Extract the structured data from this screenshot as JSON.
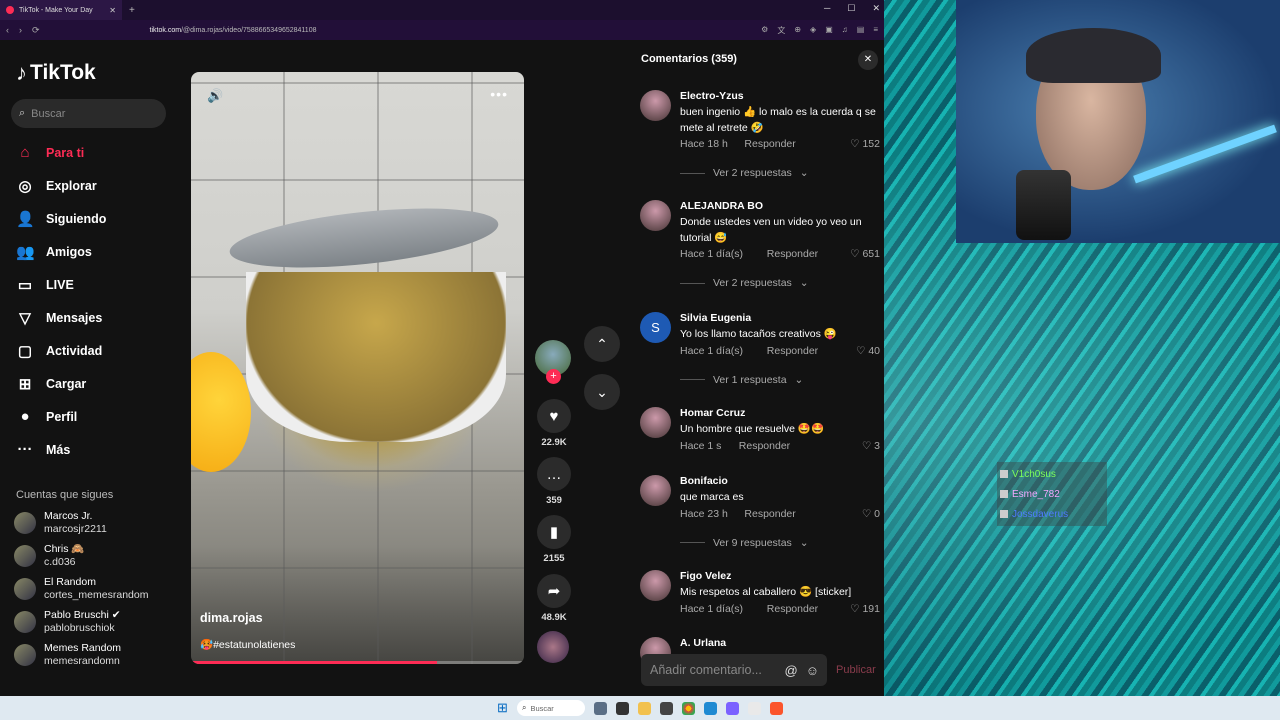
{
  "browser": {
    "tab_title": "TikTok - Make Your Day",
    "url_domain": "tiktok.com",
    "url_path": "/@dima.rojas/video/7588665349652841108",
    "new_tab": "+",
    "back": "‹",
    "forward": "›",
    "reload": "⟳"
  },
  "sidebar": {
    "logo": "TikTok",
    "search_placeholder": "Buscar",
    "nav": [
      {
        "label": "Para ti",
        "icon": "home-icon",
        "glyph": "⌂",
        "active": true
      },
      {
        "label": "Explorar",
        "icon": "compass-icon",
        "glyph": "◎"
      },
      {
        "label": "Siguiendo",
        "icon": "following-icon",
        "glyph": "👤"
      },
      {
        "label": "Amigos",
        "icon": "friends-icon",
        "glyph": "👥"
      },
      {
        "label": "LIVE",
        "icon": "live-icon",
        "glyph": "▭"
      },
      {
        "label": "Mensajes",
        "icon": "messages-icon",
        "glyph": "▽"
      },
      {
        "label": "Actividad",
        "icon": "activity-icon",
        "glyph": "▢"
      },
      {
        "label": "Cargar",
        "icon": "upload-icon",
        "glyph": "⊞"
      },
      {
        "label": "Perfil",
        "icon": "profile-icon",
        "glyph": "●"
      },
      {
        "label": "Más",
        "icon": "more-icon",
        "glyph": "···"
      }
    ],
    "following_title": "Cuentas que sigues",
    "following": [
      {
        "name": "Marcos Jr.",
        "handle": "marcosjr2211"
      },
      {
        "name": "Chris 🙈",
        "handle": "c.d036"
      },
      {
        "name": "El Random",
        "handle": "cortes_memesrandom"
      },
      {
        "name": "Pablo Bruschi ✔",
        "handle": "pablobruschiok"
      },
      {
        "name": "Memes Random",
        "handle": "memesrandomn"
      }
    ]
  },
  "video": {
    "author": "dima.rojas",
    "hashtag": "🥵#estatunolatienes",
    "progress_fraction": 0.74,
    "likes": "22.9K",
    "comments": "359",
    "saves": "2155",
    "shares": "48.9K"
  },
  "comments": {
    "title": "Comentarios (359)",
    "input_placeholder": "Añadir comentario...",
    "post_label": "Publicar",
    "items": [
      {
        "name": "Electro-Yzus",
        "text": "buen ingenio 👍 lo malo es la cuerda q se mete al retrete 🤣",
        "time": "Hace 18 h",
        "reply": "Responder",
        "likes": "152",
        "view": "Ver 2 respuestas"
      },
      {
        "name": "ALEJANDRA BO",
        "text": "Donde ustedes ven un video yo veo un tutorial 😅",
        "time": "Hace 1 día(s)",
        "reply": "Responder",
        "likes": "651",
        "view": "Ver 2 respuestas"
      },
      {
        "name": "Silvia Eugenia",
        "text": "Yo los llamo tacaños creativos 😜",
        "time": "Hace 1 día(s)",
        "reply": "Responder",
        "likes": "40",
        "view": "Ver 1 respuesta",
        "initial": "S"
      },
      {
        "name": "Homar Ccruz",
        "text": "Un hombre que resuelve 🤩🤩",
        "time": "Hace 1 s",
        "reply": "Responder",
        "likes": "3"
      },
      {
        "name": "Bonifacio",
        "text": "que marca es",
        "time": "Hace 23 h",
        "reply": "Responder",
        "likes": "0",
        "view": "Ver 9 respuestas"
      },
      {
        "name": "Figo Velez",
        "text": "Mis respetos al caballero 😎 [sticker]",
        "time": "Hace 1 día(s)",
        "reply": "Responder",
        "likes": "191"
      },
      {
        "name": "A. Urlana"
      }
    ]
  },
  "stream_chat": [
    {
      "user": "V1ch0sus",
      "color": "#7CFF5A"
    },
    {
      "user": "Esme_782",
      "color": "#F2A8FF"
    },
    {
      "user": "Jossdaverus",
      "color": "#4D7BFF"
    }
  ],
  "taskbar": {
    "search_placeholder": "Buscar"
  }
}
